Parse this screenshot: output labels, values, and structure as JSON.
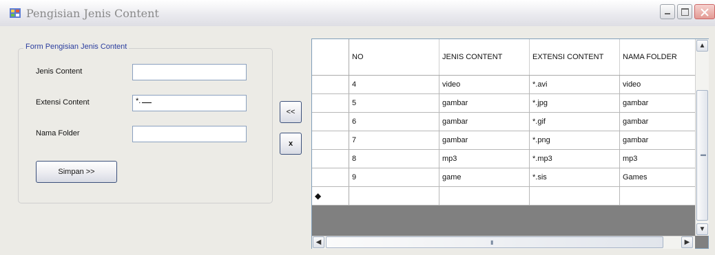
{
  "window": {
    "title": "Pengisian Jenis Content",
    "controls": {
      "minimize": "_",
      "maximize": "□",
      "close": "X"
    }
  },
  "form": {
    "group_title": "Form Pengisian Jenis Content",
    "fields": [
      {
        "label": "Jenis Content",
        "value": ""
      },
      {
        "label": "Extensi Content",
        "value": "*."
      },
      {
        "label": "Nama Folder",
        "value": ""
      }
    ],
    "save_label": "Simpan >>"
  },
  "middle_buttons": {
    "back": "<<",
    "delete": "x"
  },
  "grid": {
    "columns": [
      "NO",
      "JENIS CONTENT",
      "EXTENSI CONTENT",
      "NAMA FOLDER"
    ],
    "rows": [
      [
        "4",
        "video",
        "*.avi",
        "video"
      ],
      [
        "5",
        "gambar",
        "*.jpg",
        "gambar"
      ],
      [
        "6",
        "gambar",
        "*.gif",
        "gambar"
      ],
      [
        "7",
        "gambar",
        "*.png",
        "gambar"
      ],
      [
        "8",
        "mp3",
        "*.mp3",
        "mp3"
      ],
      [
        "9",
        "game",
        "*.sis",
        "Games"
      ]
    ],
    "new_row_marker": "◆"
  },
  "scrollbars": {
    "up": "▲",
    "down": "▼",
    "left": "◀",
    "right": "▶"
  },
  "colors": {
    "title_text": "#8a8a8a",
    "group_title": "#2a3d9e",
    "grid_empty": "#808080"
  }
}
